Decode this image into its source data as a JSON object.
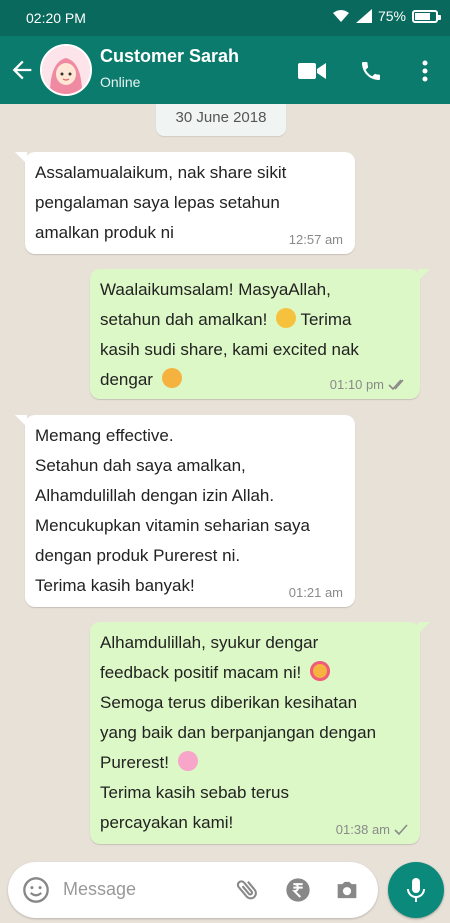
{
  "status": {
    "time": "02:20 PM",
    "battery": "75%",
    "battery_level": 0.75
  },
  "header": {
    "title": "Customer Sarah",
    "subtitle": "Online"
  },
  "date": "30 June 2018",
  "messages": [
    {
      "lines": [
        "Assalamualaikum, nak share sikit",
        "pengalaman saya lepas setahun",
        "amalkan produk ni"
      ],
      "time": "12:57 am"
    },
    {
      "lines": [
        "Waalaikumsalam! MasyaAllah,",
        "setahun dah amalkan!",
        "Terima",
        "kasih sudi share, kami excited nak",
        "dengar"
      ],
      "time": "01:10 pm"
    },
    {
      "lines": [
        "Memang effective.",
        "Setahun dah saya amalkan,",
        "Alhamdulillah dengan izin Allah.",
        "Mencukupkan vitamin seharian saya",
        "dengan produk Purerest ni.",
        "Terima kasih banyak!"
      ],
      "time": "01:21 am"
    },
    {
      "lines": [
        "Alhamdulillah, syukur dengar",
        "feedback positif macam ni!",
        "Semoga terus diberikan kesihatan",
        "yang baik dan berpanjangan dengan",
        "Purerest!",
        "Terima kasih sebab terus",
        "percayakan kami!"
      ],
      "time": "01:38 am"
    }
  ],
  "composer": {
    "placeholder": "Message"
  },
  "icons": [
    "back-arrow-icon",
    "video-call-icon",
    "phone-icon",
    "more-vert-icon",
    "emoji-icon",
    "attach-icon",
    "rupee-icon",
    "camera-icon",
    "mic-icon",
    "wifi-icon",
    "signal-icon",
    "battery-icon",
    "double-check-icon",
    "single-check-icon"
  ],
  "colors": {
    "header": "#0b7b6d",
    "statusbar": "#09695d",
    "outgoing": "#dcf8c6",
    "incoming": "#ffffff",
    "mic": "#0b8a7c"
  }
}
